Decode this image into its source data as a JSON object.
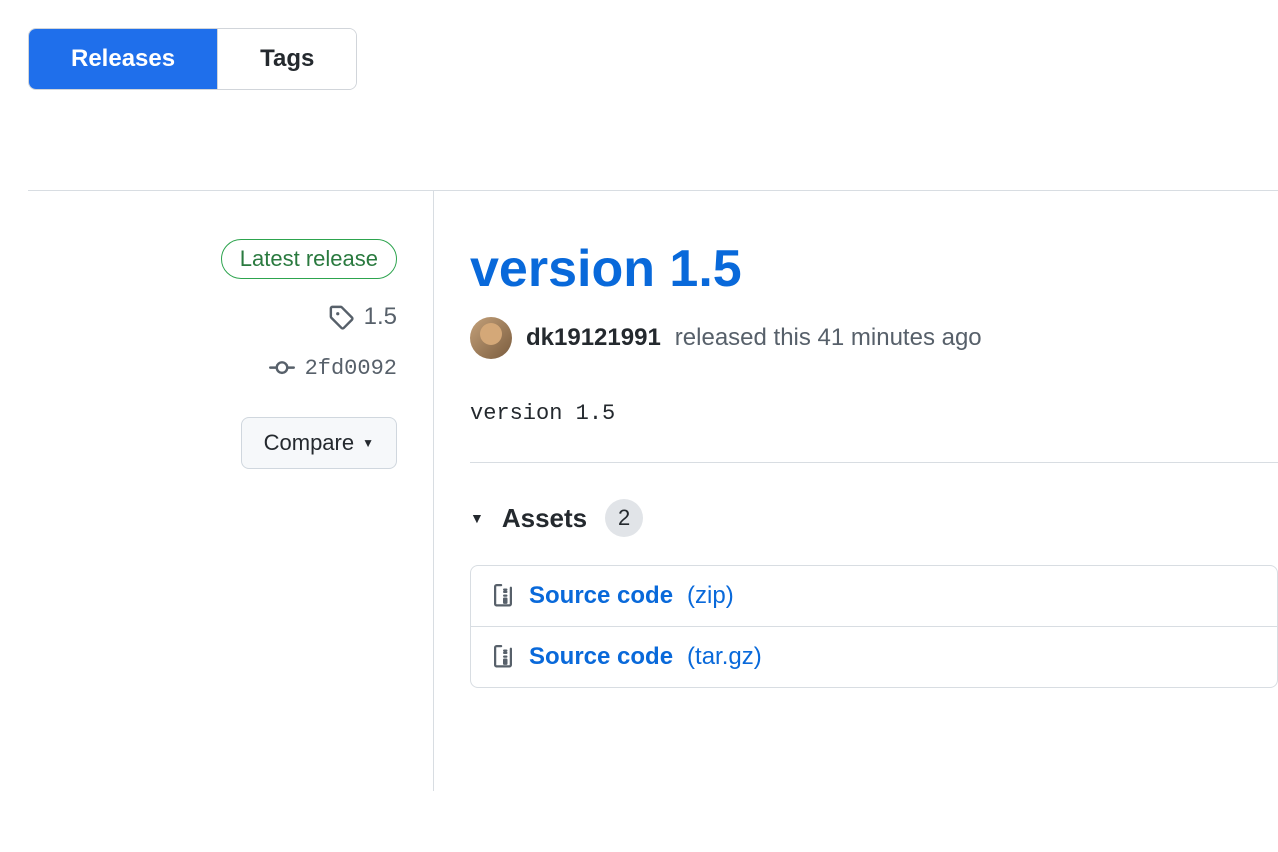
{
  "tabs": {
    "releases": "Releases",
    "tags": "Tags"
  },
  "sidebar": {
    "latest_badge": "Latest release",
    "tag": "1.5",
    "commit": "2fd0092",
    "compare_label": "Compare"
  },
  "release": {
    "title": "version 1.5",
    "username": "dk19121991",
    "released_text": "released this 41 minutes ago",
    "description": "version 1.5"
  },
  "assets": {
    "label": "Assets",
    "count": "2",
    "items": [
      {
        "name": "Source code",
        "ext": "(zip)"
      },
      {
        "name": "Source code",
        "ext": "(tar.gz)"
      }
    ]
  }
}
